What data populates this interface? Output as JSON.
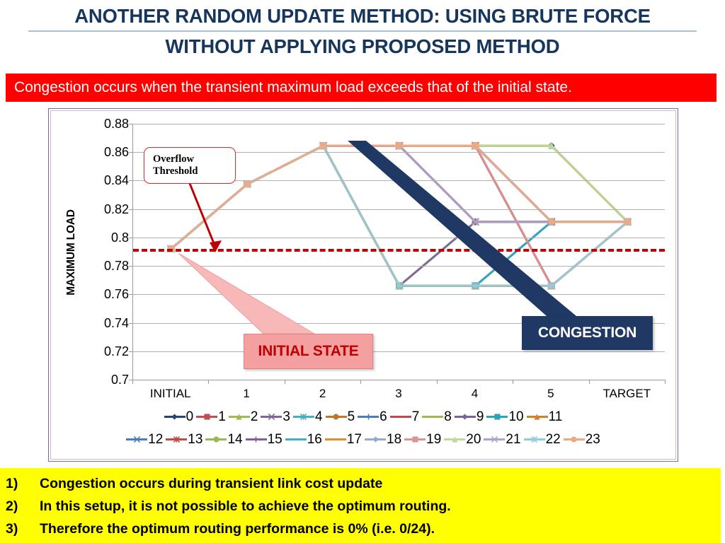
{
  "title": {
    "line1": "ANOTHER RANDOM UPDATE METHOD: USING BRUTE FORCE",
    "line2": "WITHOUT APPLYING PROPOSED METHOD",
    "color": "#17365D",
    "divider_color": "#A7C3DC"
  },
  "banner": {
    "text": "Congestion occurs when the transient maximum load exceeds that of the initial state.",
    "bg": "#FF0000",
    "fg": "#FFFFFF"
  },
  "callouts": {
    "overflow": {
      "line1": "Overflow",
      "line2": "Threshold",
      "border": "#D92B2B"
    },
    "initial_state": {
      "text": "INITIAL STATE",
      "bg": "#F4A0A0",
      "fg": "#C00000"
    },
    "congestion": {
      "text": "CONGESTION",
      "bg": "#1F3864",
      "fg": "#FFFFFF"
    }
  },
  "notes": [
    {
      "num": "1)",
      "text": "Congestion occurs during transient link cost update"
    },
    {
      "num": "2)",
      "text": "In this setup, it is not possible to achieve the optimum routing."
    },
    {
      "num": "3)",
      "text": "Therefore the optimum routing performance is 0% (i.e. 0/24)."
    }
  ],
  "notes_bg": "#FFFF00",
  "chart_data": {
    "type": "line",
    "title": "",
    "xlabel": "",
    "ylabel": "MAXIMUM LOAD",
    "categories": [
      "INITIAL",
      "1",
      "2",
      "3",
      "4",
      "5",
      "TARGET"
    ],
    "ytick_labels": [
      "0.88",
      "0.86",
      "0.84",
      "0.82",
      "0.8",
      "0.78",
      "0.76",
      "0.74",
      "0.72",
      "0.7"
    ],
    "yticks": [
      0.88,
      0.86,
      0.84,
      0.82,
      0.8,
      0.78,
      0.76,
      0.74,
      0.72,
      0.7
    ],
    "ylim": [
      0.7,
      0.88
    ],
    "grid": true,
    "legend_position": "bottom",
    "threshold": {
      "label": "Overflow Threshold",
      "value": 0.792,
      "color": "#C00000",
      "style": "dashed"
    },
    "series": [
      {
        "name": "0",
        "color": "#1F497D",
        "marker": "diamond",
        "values": [
          0.792,
          0.8375,
          0.8645,
          0.8645,
          0.8645,
          0.8645,
          0.811
        ]
      },
      {
        "name": "1",
        "color": "#C0504D",
        "marker": "square",
        "values": [
          0.792,
          0.8375,
          0.8645,
          0.8645,
          0.8645,
          0.811,
          0.811
        ]
      },
      {
        "name": "2",
        "color": "#9BBB59",
        "marker": "triangle",
        "values": [
          0.792,
          0.8375,
          0.8645,
          0.8645,
          0.8645,
          0.8645,
          0.811
        ]
      },
      {
        "name": "3",
        "color": "#8064A2",
        "marker": "x",
        "values": [
          0.792,
          0.8375,
          0.8645,
          0.8645,
          0.811,
          0.811,
          0.811
        ]
      },
      {
        "name": "4",
        "color": "#4BACC6",
        "marker": "star",
        "values": [
          0.792,
          0.8375,
          0.8645,
          0.766,
          0.766,
          0.811,
          0.811
        ]
      },
      {
        "name": "5",
        "color": "#C0762A",
        "marker": "circle",
        "values": [
          0.792,
          0.8375,
          0.8645,
          0.766,
          0.766,
          0.766,
          0.811
        ]
      },
      {
        "name": "6",
        "color": "#4A7EBB",
        "marker": "plus",
        "values": [
          0.792,
          0.8375,
          0.8645,
          0.8645,
          0.8645,
          0.811,
          0.811
        ]
      },
      {
        "name": "7",
        "color": "#BE4B48",
        "marker": "none",
        "values": [
          0.792,
          0.8375,
          0.8645,
          0.8645,
          0.8645,
          0.766,
          0.811
        ]
      },
      {
        "name": "8",
        "color": "#98B954",
        "marker": "none",
        "values": [
          0.792,
          0.8375,
          0.8645,
          0.8645,
          0.8645,
          0.8645,
          0.811
        ]
      },
      {
        "name": "9",
        "color": "#7D60A0",
        "marker": "diamond",
        "values": [
          0.792,
          0.8375,
          0.8645,
          0.8645,
          0.811,
          0.811,
          0.811
        ]
      },
      {
        "name": "10",
        "color": "#2DA2BF",
        "marker": "square",
        "values": [
          0.792,
          0.8375,
          0.8645,
          0.766,
          0.766,
          0.811,
          0.811
        ]
      },
      {
        "name": "11",
        "color": "#D2802D",
        "marker": "triangle",
        "values": [
          0.792,
          0.8375,
          0.8645,
          0.766,
          0.766,
          0.766,
          0.811
        ]
      },
      {
        "name": "12",
        "color": "#4A7EBB",
        "marker": "x",
        "values": [
          0.792,
          0.8375,
          0.8645,
          0.8645,
          0.8645,
          0.811,
          0.811
        ]
      },
      {
        "name": "13",
        "color": "#BE4B48",
        "marker": "star",
        "values": [
          0.792,
          0.8375,
          0.8645,
          0.8645,
          0.8645,
          0.766,
          0.811
        ]
      },
      {
        "name": "14",
        "color": "#98B954",
        "marker": "circle",
        "values": [
          0.792,
          0.8375,
          0.8645,
          0.766,
          0.811,
          0.811,
          0.811
        ]
      },
      {
        "name": "15",
        "color": "#7D60A0",
        "marker": "plus",
        "values": [
          0.792,
          0.8375,
          0.8645,
          0.766,
          0.811,
          0.811,
          0.811
        ]
      },
      {
        "name": "16",
        "color": "#3EB0C8",
        "marker": "none",
        "values": [
          0.792,
          0.8375,
          0.8645,
          0.766,
          0.766,
          0.766,
          0.811
        ]
      },
      {
        "name": "17",
        "color": "#E8882F",
        "marker": "none",
        "values": [
          0.792,
          0.8375,
          0.8645,
          0.766,
          0.766,
          0.766,
          0.811
        ]
      },
      {
        "name": "18",
        "color": "#95A8D6",
        "marker": "diamond",
        "values": [
          0.792,
          0.8375,
          0.8645,
          0.8645,
          0.8645,
          0.811,
          0.811
        ]
      },
      {
        "name": "19",
        "color": "#D99694",
        "marker": "square",
        "values": [
          0.792,
          0.8375,
          0.8645,
          0.8645,
          0.8645,
          0.766,
          0.811
        ]
      },
      {
        "name": "20",
        "color": "#C3D69B",
        "marker": "triangle",
        "values": [
          0.792,
          0.8375,
          0.8645,
          0.8645,
          0.8645,
          0.8645,
          0.811
        ]
      },
      {
        "name": "21",
        "color": "#B3A2C7",
        "marker": "x",
        "values": [
          0.792,
          0.8375,
          0.8645,
          0.8645,
          0.811,
          0.811,
          0.811
        ]
      },
      {
        "name": "22",
        "color": "#92CDDC",
        "marker": "star",
        "values": [
          0.792,
          0.8375,
          0.8645,
          0.766,
          0.766,
          0.766,
          0.811
        ]
      },
      {
        "name": "23",
        "color": "#F0A882",
        "marker": "circle",
        "values": [
          0.792,
          0.8375,
          0.8645,
          0.8645,
          0.8645,
          0.811,
          0.811
        ]
      }
    ]
  }
}
